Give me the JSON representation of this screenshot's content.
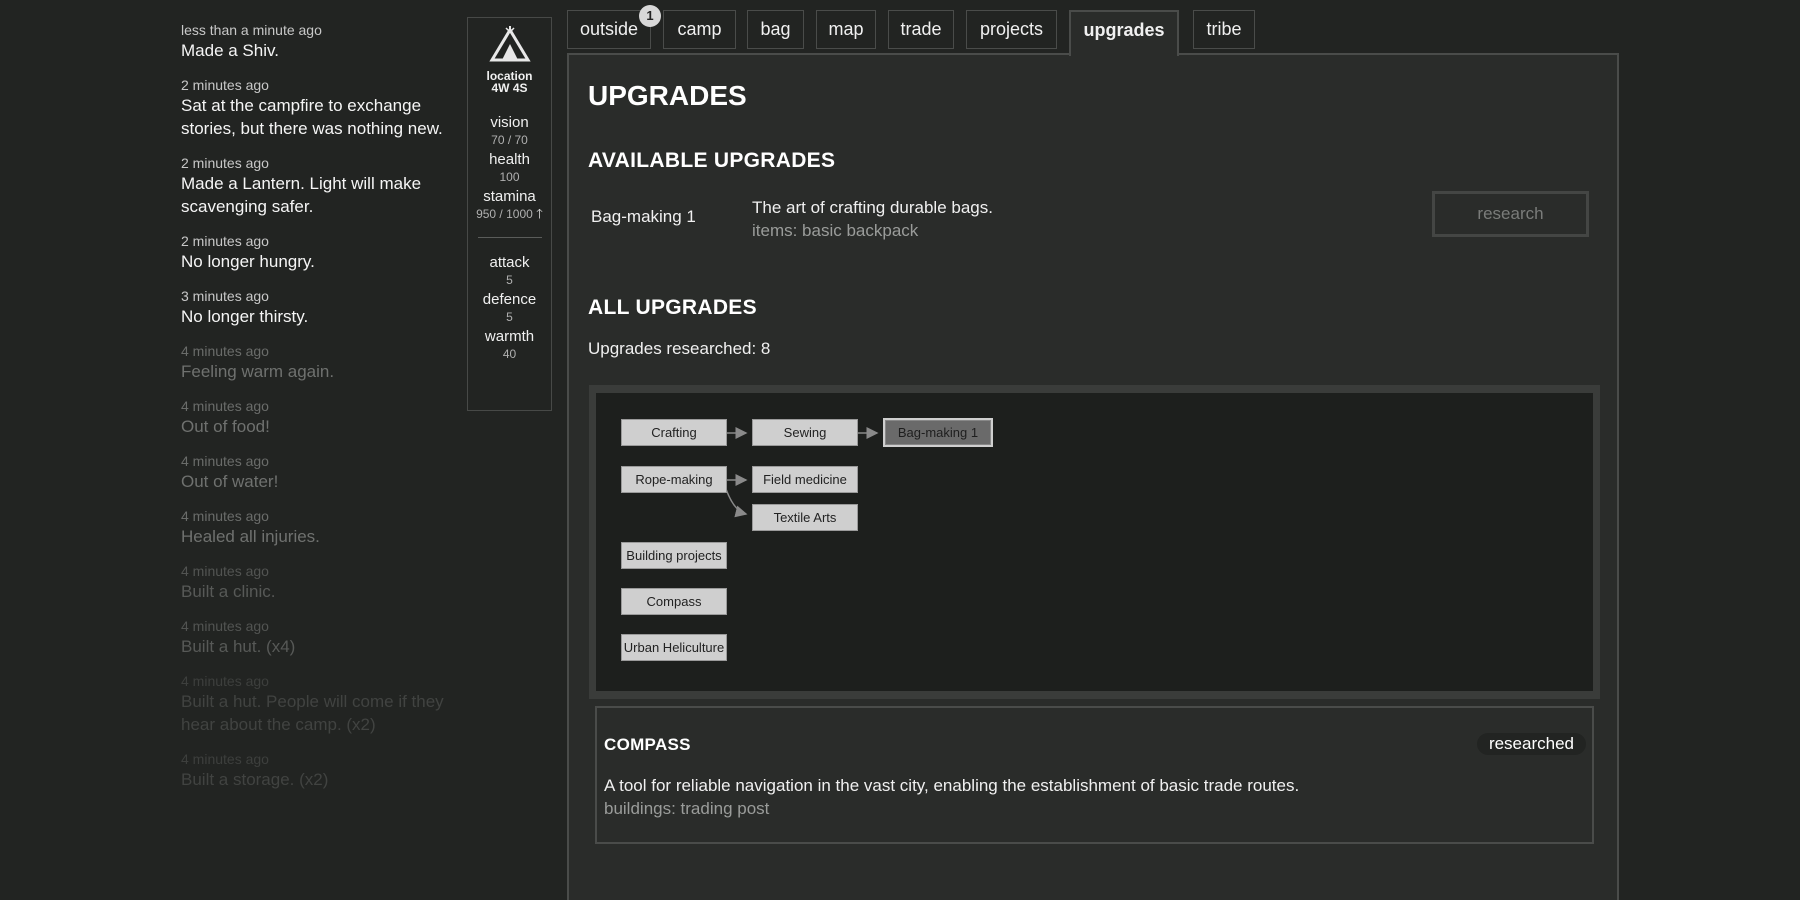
{
  "log": [
    {
      "time": "less than a minute ago",
      "text": "Made a Shiv."
    },
    {
      "time": "2 minutes ago",
      "text": "Sat at the campfire to exchange stories, but there was nothing new."
    },
    {
      "time": "2 minutes ago",
      "text": "Made a Lantern. Light will make scavenging safer."
    },
    {
      "time": "2 minutes ago",
      "text": "No longer hungry."
    },
    {
      "time": "3 minutes ago",
      "text": "No longer thirsty."
    },
    {
      "time": "4 minutes ago",
      "text": "Feeling warm again."
    },
    {
      "time": "4 minutes ago",
      "text": "Out of food!"
    },
    {
      "time": "4 minutes ago",
      "text": "Out of water!"
    },
    {
      "time": "4 minutes ago",
      "text": "Healed all injuries."
    },
    {
      "time": "4 minutes ago",
      "text": "Built a clinic."
    },
    {
      "time": "4 minutes ago",
      "text": "Built a hut. (x4)"
    },
    {
      "time": "4 minutes ago",
      "text": "Built a hut. People will come if they hear about the camp. (x2)"
    },
    {
      "time": "4 minutes ago",
      "text": "Built a storage. (x2)"
    }
  ],
  "stats": {
    "location_label": "location",
    "location_value": "4W 4S",
    "vision_label": "vision",
    "vision_value": "70 / 70",
    "health_label": "health",
    "health_value": "100",
    "stamina_label": "stamina",
    "stamina_value": "950 / 1000",
    "stamina_arrow": "🡑",
    "attack_label": "attack",
    "attack_value": "5",
    "defence_label": "defence",
    "defence_value": "5",
    "warmth_label": "warmth",
    "warmth_value": "40"
  },
  "tabs": [
    {
      "label": "outside",
      "badge": "1"
    },
    {
      "label": "camp"
    },
    {
      "label": "bag"
    },
    {
      "label": "map"
    },
    {
      "label": "trade"
    },
    {
      "label": "projects"
    },
    {
      "label": "upgrades",
      "active": true
    },
    {
      "label": "tribe"
    }
  ],
  "main": {
    "title": "UPGRADES",
    "available_title": "AVAILABLE UPGRADES",
    "available": {
      "name": "Bag-making 1",
      "desc": "The art of crafting durable bags.",
      "items": "items: basic backpack",
      "button": "research"
    },
    "all_title": "ALL UPGRADES",
    "researched_count": "Upgrades researched: 8",
    "tree": {
      "nodes": [
        {
          "label": "Crafting"
        },
        {
          "label": "Sewing"
        },
        {
          "label": "Bag-making 1",
          "state": "available"
        },
        {
          "label": "Rope-making"
        },
        {
          "label": "Field medicine"
        },
        {
          "label": "Textile Arts"
        },
        {
          "label": "Building projects"
        },
        {
          "label": "Compass"
        },
        {
          "label": "Urban Heliculture"
        }
      ]
    },
    "detail": {
      "title": "COMPASS",
      "status": "researched",
      "desc": "A tool for reliable navigation in the vast city, enabling the establishment of basic trade routes.",
      "items": "buildings: trading post"
    }
  }
}
